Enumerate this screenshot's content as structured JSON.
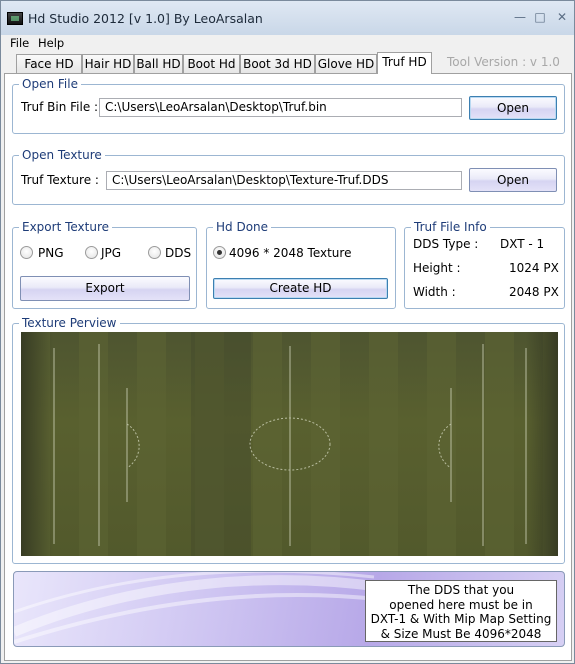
{
  "window": {
    "title": "Hd Studio 2012  [v 1.0] By LeoArsalan",
    "minimize": "—",
    "maximize": "□",
    "close": "✕"
  },
  "menu": [
    "File",
    "Help"
  ],
  "tabs": [
    "Face HD",
    "Hair HD",
    "Ball HD",
    "Boot Hd",
    "Boot 3d HD",
    "Glove HD",
    "Truf HD"
  ],
  "active_tab": "Truf HD",
  "tool_version": "Tool Version : v 1.0",
  "open_file": {
    "group": "Open File",
    "label": "Truf Bin File :",
    "value": "C:\\Users\\LeoArsalan\\Desktop\\Truf.bin",
    "button": "Open"
  },
  "open_texture": {
    "group": "Open Texture",
    "label": "Truf Texture :",
    "value": "C:\\Users\\LeoArsalan\\Desktop\\Texture-Truf.DDS",
    "button": "Open"
  },
  "export_texture": {
    "group": "Export Texture",
    "options": [
      "PNG",
      "JPG",
      "DDS"
    ],
    "button": "Export"
  },
  "hd_done": {
    "group": "Hd Done",
    "option": "4096 * 2048 Texture",
    "button": "Create HD"
  },
  "file_info": {
    "group": "Truf  File Info",
    "dds_type_label": "DDS Type :",
    "dds_type_value": "DXT - 1",
    "height_label": "Height :",
    "height_value": "1024 PX",
    "width_label": "Width :",
    "width_value": "2048 PX"
  },
  "texture_preview": {
    "group": "Texture Perview"
  },
  "note": [
    "The DDS that you",
    "opened here must be in",
    "DXT-1 & With Mip Map Setting",
    "& Size Must Be 4096*2048"
  ],
  "colors": {
    "pitch": "#555c2e",
    "group_border": "#9cb6d2",
    "group_title": "#1e3c78",
    "button_purple": "#d6d4f2"
  }
}
